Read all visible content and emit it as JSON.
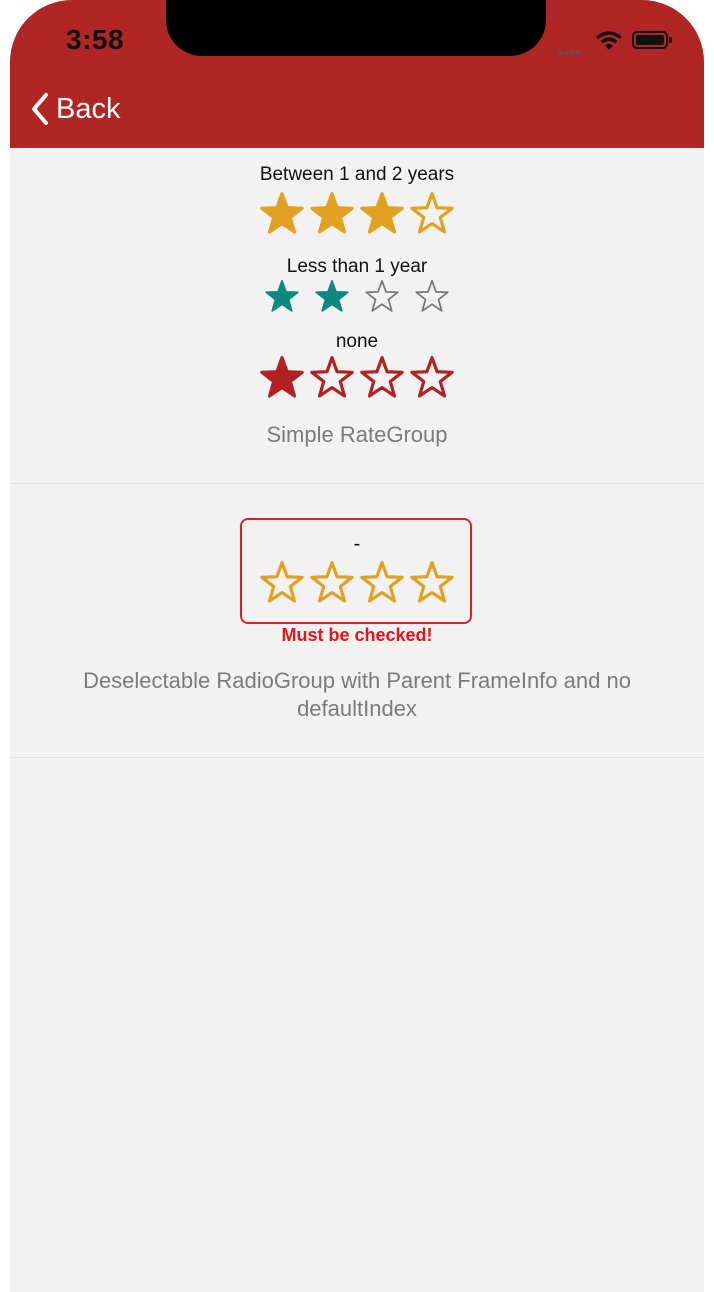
{
  "status_bar": {
    "time": "3:58"
  },
  "nav": {
    "back_label": "Back"
  },
  "colors": {
    "header": "#b02624",
    "gold": "#e2a121",
    "teal": "#0c8a80",
    "gray_outline": "#7b7b7b",
    "red": "#b22222",
    "error": "#e6141c"
  },
  "rate_groups": [
    {
      "label": "Between 1 and 2 years",
      "rating": 3,
      "max": 4,
      "color": "gold",
      "style": "large"
    },
    {
      "label": "Less than 1 year",
      "rating": 2,
      "max": 4,
      "color": "teal",
      "style": "small"
    },
    {
      "label": "none",
      "rating": 1,
      "max": 4,
      "color": "red",
      "style": "large"
    }
  ],
  "simple_caption": "Simple RateGroup",
  "deselectable": {
    "value_text": "-",
    "rating": 0,
    "max": 4,
    "color": "gold",
    "error_text": "Must be checked!",
    "caption_line1": "Deselectable RadioGroup with Parent FrameInfo and no",
    "caption_line2": "defaultIndex"
  }
}
